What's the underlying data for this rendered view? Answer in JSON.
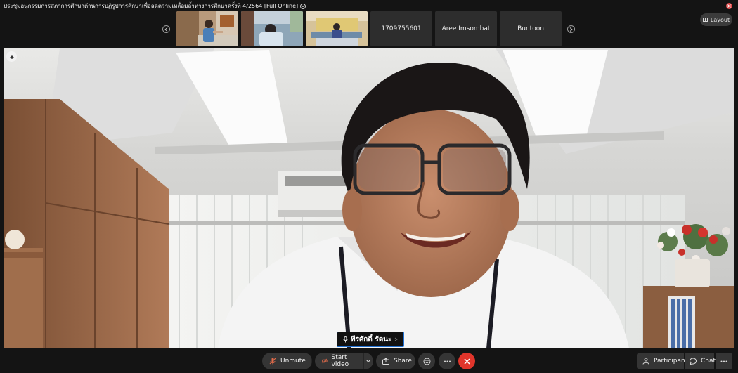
{
  "window": {
    "meeting_title": "ประชุมอนุกรรมการสภาการศึกษาด้านการปฏิรูปการศึกษาเพื่อลดความเหลื่อมล้ำทางการศึกษาครั้งที่ 4/2564 [Full Online]",
    "layout_label": "Layout"
  },
  "participants_strip": {
    "thumbnails": [
      {
        "type": "video",
        "icon": "participant-video-thumbnail"
      },
      {
        "type": "video",
        "icon": "participant-video-thumbnail"
      },
      {
        "type": "video",
        "icon": "participant-video-thumbnail"
      },
      {
        "type": "name",
        "label": "1709755601"
      },
      {
        "type": "name",
        "label": "Aree Imsombat"
      },
      {
        "type": "name",
        "label": "Buntoon"
      }
    ]
  },
  "main_video": {
    "speaker_name": "พีรศักดิ์ รัตนะ",
    "active_speaker_color": "#1f6fd1"
  },
  "toolbar": {
    "unmute_label": "Unmute",
    "start_video_label": "Start video",
    "share_label": "Share",
    "participants_label": "Participants",
    "chat_label": "Chat"
  },
  "colors": {
    "background": "#141414",
    "button": "#353535",
    "leave": "#e0352b",
    "close": "#e24a4a"
  }
}
